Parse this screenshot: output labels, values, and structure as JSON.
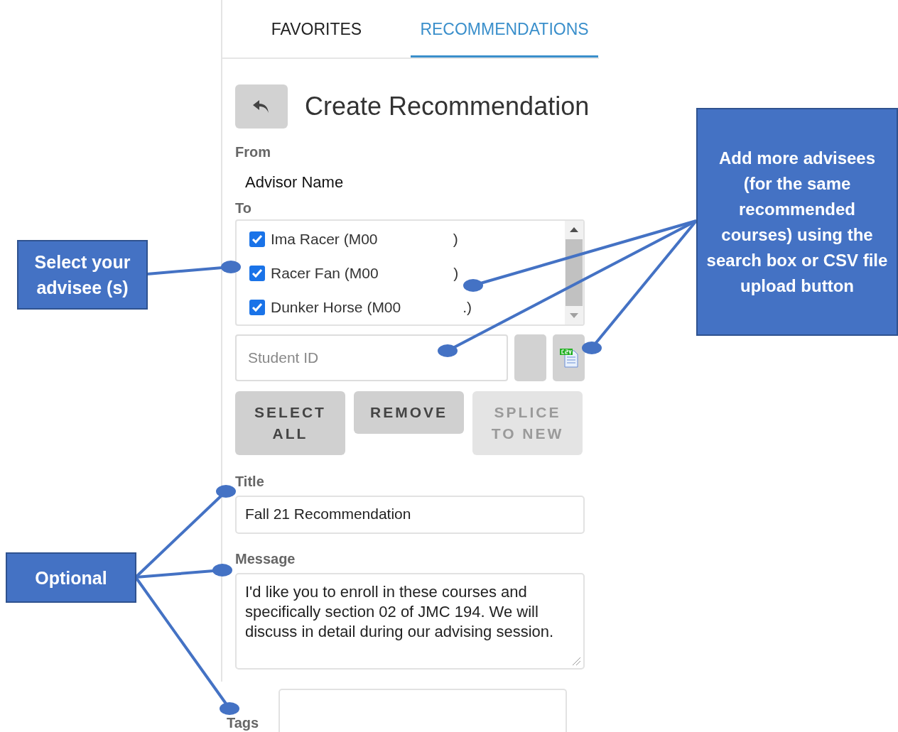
{
  "tabs": [
    {
      "label": "FAVORITES",
      "selected": false
    },
    {
      "label": "RECOMMENDATIONS",
      "selected": true
    }
  ],
  "header": {
    "title": "Create Recommendation"
  },
  "from": {
    "label": "From",
    "value": "Advisor Name"
  },
  "to": {
    "label": "To",
    "advisees": [
      {
        "name": "Ima Racer (M00",
        "suffix": ")",
        "checked": true
      },
      {
        "name": "Racer Fan (M00",
        "suffix": ")",
        "checked": true
      },
      {
        "name": "Dunker Horse (M00",
        "suffix": ".)",
        "checked": true
      }
    ],
    "search": {
      "placeholder": "Student ID"
    }
  },
  "actions": [
    {
      "label": "SELECT ALL",
      "disabled": false
    },
    {
      "label": "REMOVE",
      "disabled": false
    },
    {
      "label": "SPLICE TO NEW",
      "disabled": true
    }
  ],
  "title_field": {
    "label": "Title",
    "value": "Fall 21 Recommendation"
  },
  "message_field": {
    "label": "Message",
    "value": "I'd like you to enroll in these courses and specifically section 02 of JMC 194. We will discuss in detail during our advising session."
  },
  "tags_field": {
    "label": "Tags"
  },
  "callouts": [
    {
      "text": "Select your advisee (s)",
      "kind": "left"
    },
    {
      "text": "Optional",
      "kind": "left"
    },
    {
      "text": "Add more advisees (for the same recommended courses) using the search box or CSV file upload button",
      "kind": "right"
    }
  ]
}
